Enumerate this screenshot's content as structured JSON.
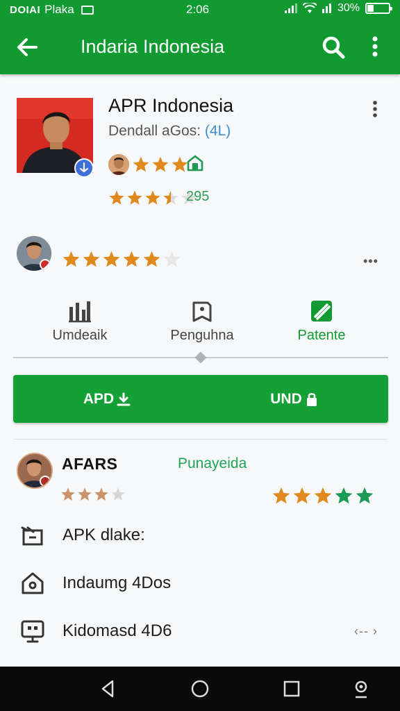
{
  "status_bar": {
    "carrier": "DOIAI",
    "name": "Plaka",
    "time": "2:06",
    "battery": "30%",
    "battery_fraction": 0.3
  },
  "app_bar": {
    "title": "Indaria Indonesia"
  },
  "app": {
    "name": "APR Indonesia",
    "developer_prefix": "Dendall aGos: ",
    "developer_accent": "(4L)",
    "rating_stars": 3.5,
    "mini_rating": 3,
    "rating_count": "295"
  },
  "user_review": {
    "stars": 5
  },
  "tabs": [
    {
      "label": "Umdeaik",
      "icon": "chart-bars-icon"
    },
    {
      "label": "Penguhna",
      "icon": "tag-icon"
    },
    {
      "label": "Patente",
      "icon": "edit-check-icon"
    }
  ],
  "buttons": {
    "left_label": "APD",
    "right_label": "UND"
  },
  "reviewer": {
    "name": "AFARS",
    "tag": "Punayeida",
    "left_stars": 3,
    "right_stars": 5
  },
  "info_rows": [
    {
      "text": "APK dlake:",
      "icon": "package-icon"
    },
    {
      "text": "Indaumg 4Dos",
      "icon": "home-lock-icon"
    },
    {
      "text": "Kidomasd 4D6",
      "icon": "monitor-icon",
      "chevron": "‹-- ›"
    }
  ],
  "colors": {
    "brand_green": "#129a32",
    "star_orange": "#e08a1e",
    "star_green": "#1a9a55",
    "accent_blue": "#3b8fcf"
  }
}
